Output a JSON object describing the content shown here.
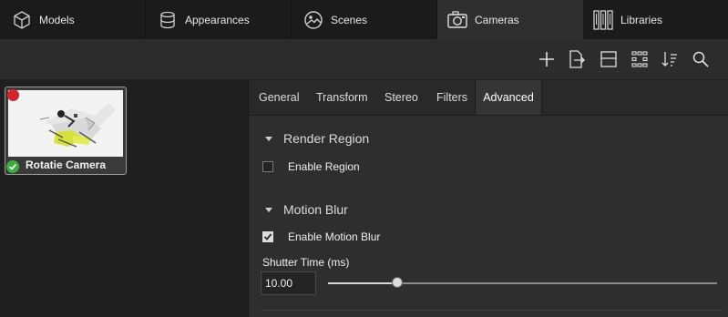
{
  "tabs": [
    {
      "label": "Models",
      "icon": "cube-icon"
    },
    {
      "label": "Appearances",
      "icon": "cylinder-icon"
    },
    {
      "label": "Scenes",
      "icon": "image-icon"
    },
    {
      "label": "Cameras",
      "icon": "camera-icon",
      "active": true
    },
    {
      "label": "Libraries",
      "icon": "books-icon"
    }
  ],
  "toolbar": {
    "icons": [
      "plus-icon",
      "export-icon",
      "layout-icon",
      "grid-view-icon",
      "sort-icon",
      "search-icon"
    ]
  },
  "camera_item": {
    "label": "Rotatie Camera",
    "status_icons": [
      "red-dot-icon",
      "green-check-icon"
    ]
  },
  "subtabs": [
    "General",
    "Transform",
    "Stereo",
    "Filters",
    "Advanced"
  ],
  "active_subtab": "Advanced",
  "render_region": {
    "header": "Render Region",
    "enable_label": "Enable Region",
    "enabled": false
  },
  "motion_blur": {
    "header": "Motion Blur",
    "enable_label": "Enable Motion Blur",
    "enabled": true,
    "shutter_label": "Shutter Time (ms)",
    "shutter_value": "10.00",
    "slider_fraction": 0.178
  },
  "colors": {
    "background": "#2b2b2b",
    "tabbar": "#1b1b1b",
    "red_status": "#d8232a",
    "green_status": "#3aae3a"
  }
}
